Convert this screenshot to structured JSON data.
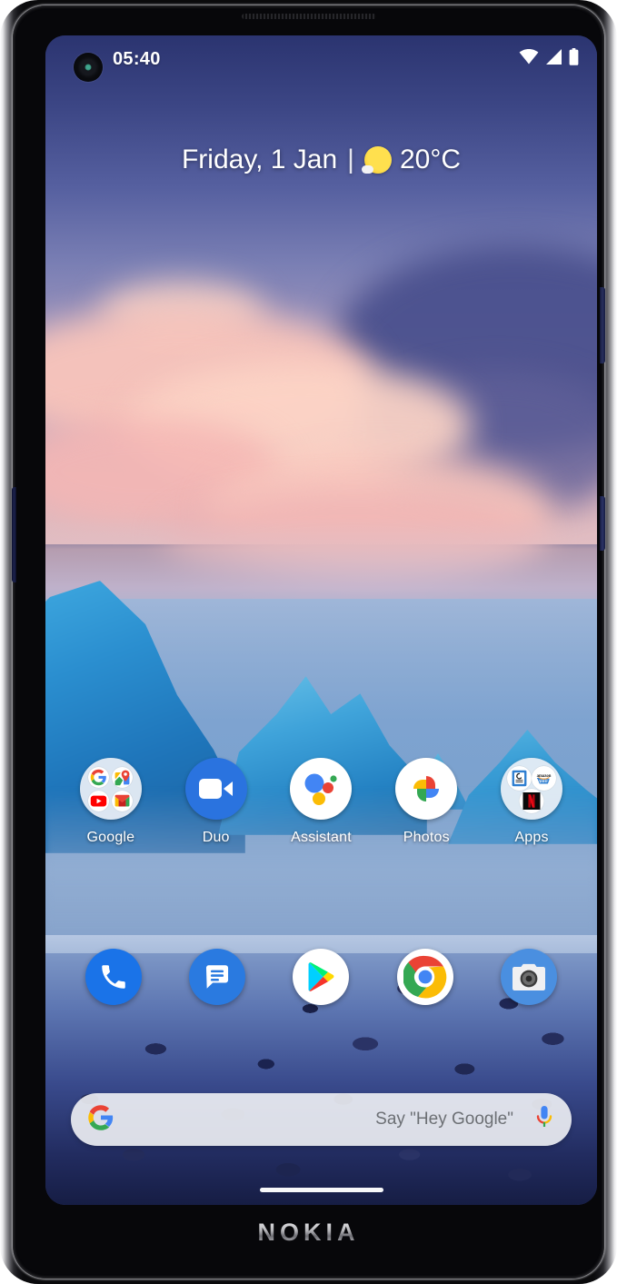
{
  "device": {
    "brand": "NOKIA",
    "buttons": {
      "volume_key": "volume-rocker",
      "power_key": "power-button",
      "assistant_key": "google-assistant-key"
    }
  },
  "status_bar": {
    "time": "05:40",
    "icons": [
      "wifi-icon",
      "cellular-signal-icon",
      "battery-icon"
    ]
  },
  "widget": {
    "date": "Friday, 1 Jan",
    "separator": "|",
    "weather_icon": "sun-icon",
    "temperature": "20°C"
  },
  "app_row": [
    {
      "label": "Google",
      "icon": "google-folder-icon",
      "type": "folder",
      "contents": [
        "google-search-icon",
        "google-maps-icon",
        "youtube-icon",
        "gmail-icon"
      ]
    },
    {
      "label": "Duo",
      "icon": "google-duo-icon",
      "type": "app",
      "color": "#2a73df"
    },
    {
      "label": "Assistant",
      "icon": "google-assistant-icon",
      "type": "app",
      "color": "#ffffff"
    },
    {
      "label": "Photos",
      "icon": "google-photos-icon",
      "type": "app",
      "color": "#ffffff"
    },
    {
      "label": "Apps",
      "icon": "apps-folder-icon",
      "type": "folder",
      "contents": [
        "kindle-icon",
        "amazon-icon",
        "netflix-icon"
      ]
    }
  ],
  "dock": [
    {
      "name": "phone-icon",
      "color": "#1a73e8"
    },
    {
      "name": "messages-icon",
      "color": "#2a7ae0"
    },
    {
      "name": "play-store-icon",
      "color": "#ffffff"
    },
    {
      "name": "chrome-icon",
      "color": "#ffffff"
    },
    {
      "name": "camera-icon",
      "color": "#4a8fe0"
    }
  ],
  "search": {
    "logo": "google-g-icon",
    "placeholder": "Say \"Hey Google\"",
    "mic": "microphone-icon"
  },
  "colors": {
    "accent_blue": "#2a73df",
    "google_blue": "#4285f4",
    "google_red": "#ea4335",
    "google_yellow": "#fbbc05",
    "google_green": "#34a853",
    "netflix_red": "#e50914",
    "amazon_orange": "#f79b34",
    "sun_yellow": "#f6c325"
  }
}
